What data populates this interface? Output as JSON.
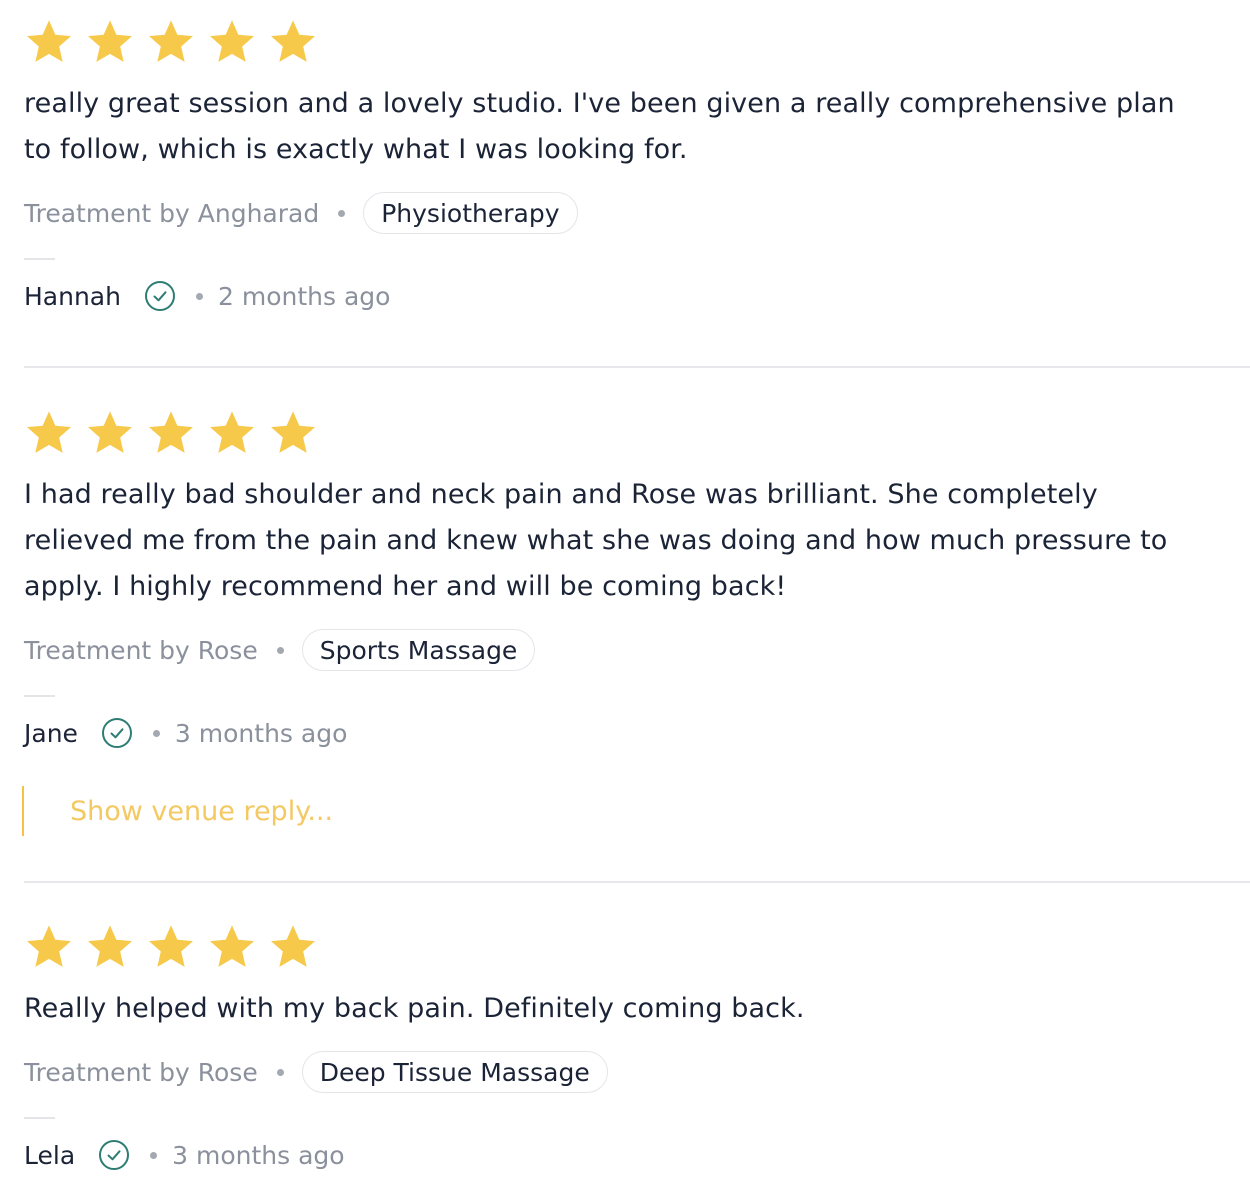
{
  "colors": {
    "star": "#f7c94a",
    "verified": "#2e7d74",
    "reply_accent": "#f4c344"
  },
  "reviews": [
    {
      "rating": 5,
      "text": "really great session and a lovely studio. I've been given a really comprehensive plan to follow, which is exactly what I was looking for.",
      "treatment": "Treatment by Angharad",
      "tag": "Physiotherapy",
      "author": "Hannah",
      "time": "2 months ago"
    },
    {
      "rating": 5,
      "text": "I had really bad shoulder and neck pain and Rose was brilliant. She completely relieved me from the pain and knew what she was doing and how much pressure to apply. I highly recommend her and will be coming back!",
      "treatment": "Treatment by Rose",
      "tag": "Sports Massage",
      "author": "Jane",
      "time": "3 months ago",
      "reply_link": "Show venue reply..."
    },
    {
      "rating": 5,
      "text": "Really helped with my back pain. Definitely coming back.",
      "treatment": "Treatment by Rose",
      "tag": "Deep Tissue Massage",
      "author": "Lela",
      "time": "3 months ago"
    }
  ]
}
